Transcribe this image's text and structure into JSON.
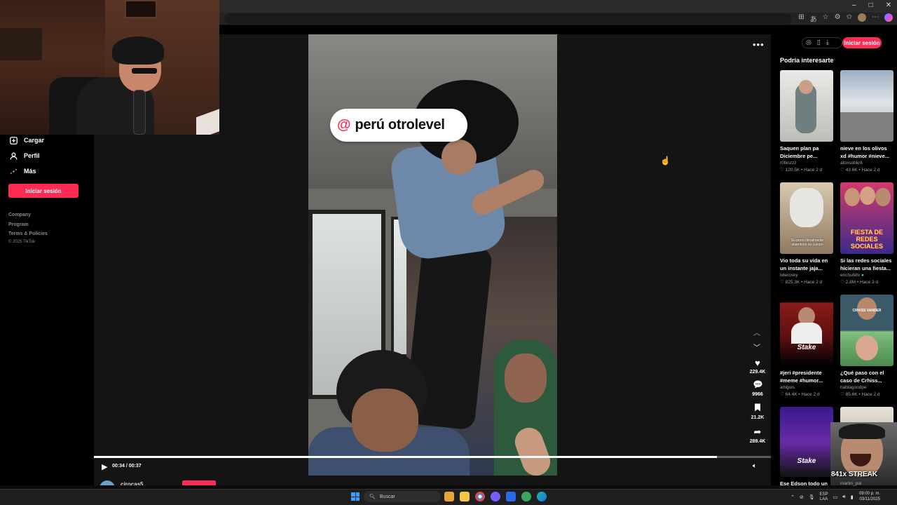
{
  "browser": {
    "window_controls": [
      "–",
      "□",
      "✕"
    ],
    "toolbar_icons": [
      "read-aloud-icon",
      "translate-icon",
      "favorite-icon",
      "extensions-icon",
      "favorites-bar-icon",
      "profile-icon",
      "menu-icon",
      "copilot-icon"
    ]
  },
  "sidebar": {
    "items": [
      {
        "label": "Cargar",
        "icon": "upload-icon"
      },
      {
        "label": "Perfil",
        "icon": "profile-icon"
      },
      {
        "label": "Más",
        "icon": "more-icon"
      }
    ],
    "login_label": "Iniciar sesión",
    "footer_links": [
      "Company",
      "Program",
      "Terms & Policies"
    ],
    "copyright": "© 2025 TikTok"
  },
  "video": {
    "caption_at": "@",
    "caption_text": "perú otrolevel",
    "current_time": "00:34 / 00:37",
    "progress": 0.92,
    "author": "cirocas5"
  },
  "actions": [
    {
      "icon": "heart-icon",
      "count": "229.4K"
    },
    {
      "icon": "comment-icon",
      "count": "9966"
    },
    {
      "icon": "bookmark-icon",
      "count": "21.2K"
    },
    {
      "icon": "share-icon",
      "count": "289.4K"
    }
  ],
  "top_right": {
    "login_label": "Iniciar sesión"
  },
  "recommendations": {
    "title": "Podría interesarte",
    "cards": [
      {
        "title": "Saquen plan pa Diciembre pe...",
        "user": "r0llinzzz",
        "likes": "♡ 120.5K",
        "time": "Hace 2 d",
        "thumb_text": ""
      },
      {
        "title": "nieve en los olivos xd #humor #nieve...",
        "user": "alonsobkr8",
        "likes": "♡ 43.6K",
        "time": "Hace 2 d",
        "thumb_text": ""
      },
      {
        "title": "Vio toda su vida en un instante jaja...",
        "user": "liderosky",
        "likes": "♡ 825.3K",
        "time": "Hace 2 d",
        "thumb_text": "Su perro literalmente abandonó su cuerpo"
      },
      {
        "title": "Si las redes sociales hicieran una fiesta...",
        "user": "enchufetv",
        "likes": "♡ 2.8M",
        "time": "Hace 3 d",
        "thumb_text": "FIESTA DE REDES SOCIALES"
      },
      {
        "title": "#jeri #presidente #meme #humor...",
        "user": "artiguis",
        "likes": "♡ 64.4K",
        "time": "Hace 2 d",
        "thumb_text": "Stake"
      },
      {
        "title": "¿Qué paso con el caso de Crhiss...",
        "user": "hablagoodpe",
        "likes": "♡ 85.6K",
        "time": "Hace 2 d",
        "thumb_text": "CRHISS VANDER"
      },
      {
        "title": "Ese Edson todo un",
        "user": "",
        "likes": "",
        "time": "",
        "thumb_text": "Stake"
      },
      {
        "title": "",
        "user": "martin_pal",
        "likes": "",
        "time": "",
        "thumb_text": ""
      }
    ]
  },
  "overlay": {
    "streak": "841x STREAK"
  },
  "taskbar": {
    "search_placeholder": "Buscar",
    "lang_top": "ESP",
    "lang_bottom": "LAA",
    "time": "09:00 p. m.",
    "date": "03/11/2025"
  }
}
